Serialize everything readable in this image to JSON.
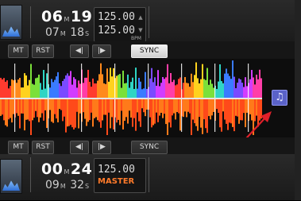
{
  "deck_top": {
    "elapsed_min": "06",
    "elapsed_min_unit": "M",
    "elapsed_sec": "19",
    "elapsed_sec_unit": "S",
    "remain_min": "07",
    "remain_min_unit": "M",
    "remain_sec": "18",
    "remain_sec_unit": "S",
    "bpm_value": "125.00",
    "bpm_value_2": "125.00",
    "bpm_unit": "BPM"
  },
  "controls_top": {
    "mt_label": "MT",
    "rst_label": "RST",
    "prev_beat_label": "◀|",
    "next_beat_label": "|▶",
    "sync_label": "SYNC",
    "sync_active": true
  },
  "waveform": {
    "note_icon": "music-note-icon",
    "annotation_color": "#e0202a",
    "note_button_color": "#5a62c8"
  },
  "controls_bottom": {
    "mt_label": "MT",
    "rst_label": "RST",
    "prev_beat_label": "◀|",
    "next_beat_label": "|▶",
    "sync_label": "SYNC",
    "sync_active": false
  },
  "deck_bottom": {
    "elapsed_min": "00",
    "elapsed_min_unit": "M",
    "elapsed_sec": "24",
    "elapsed_sec_unit": "S",
    "remain_min": "09",
    "remain_min_unit": "M",
    "remain_sec": "32",
    "remain_sec_unit": "S",
    "bpm_value": "125.00",
    "master_label": "MASTER"
  }
}
